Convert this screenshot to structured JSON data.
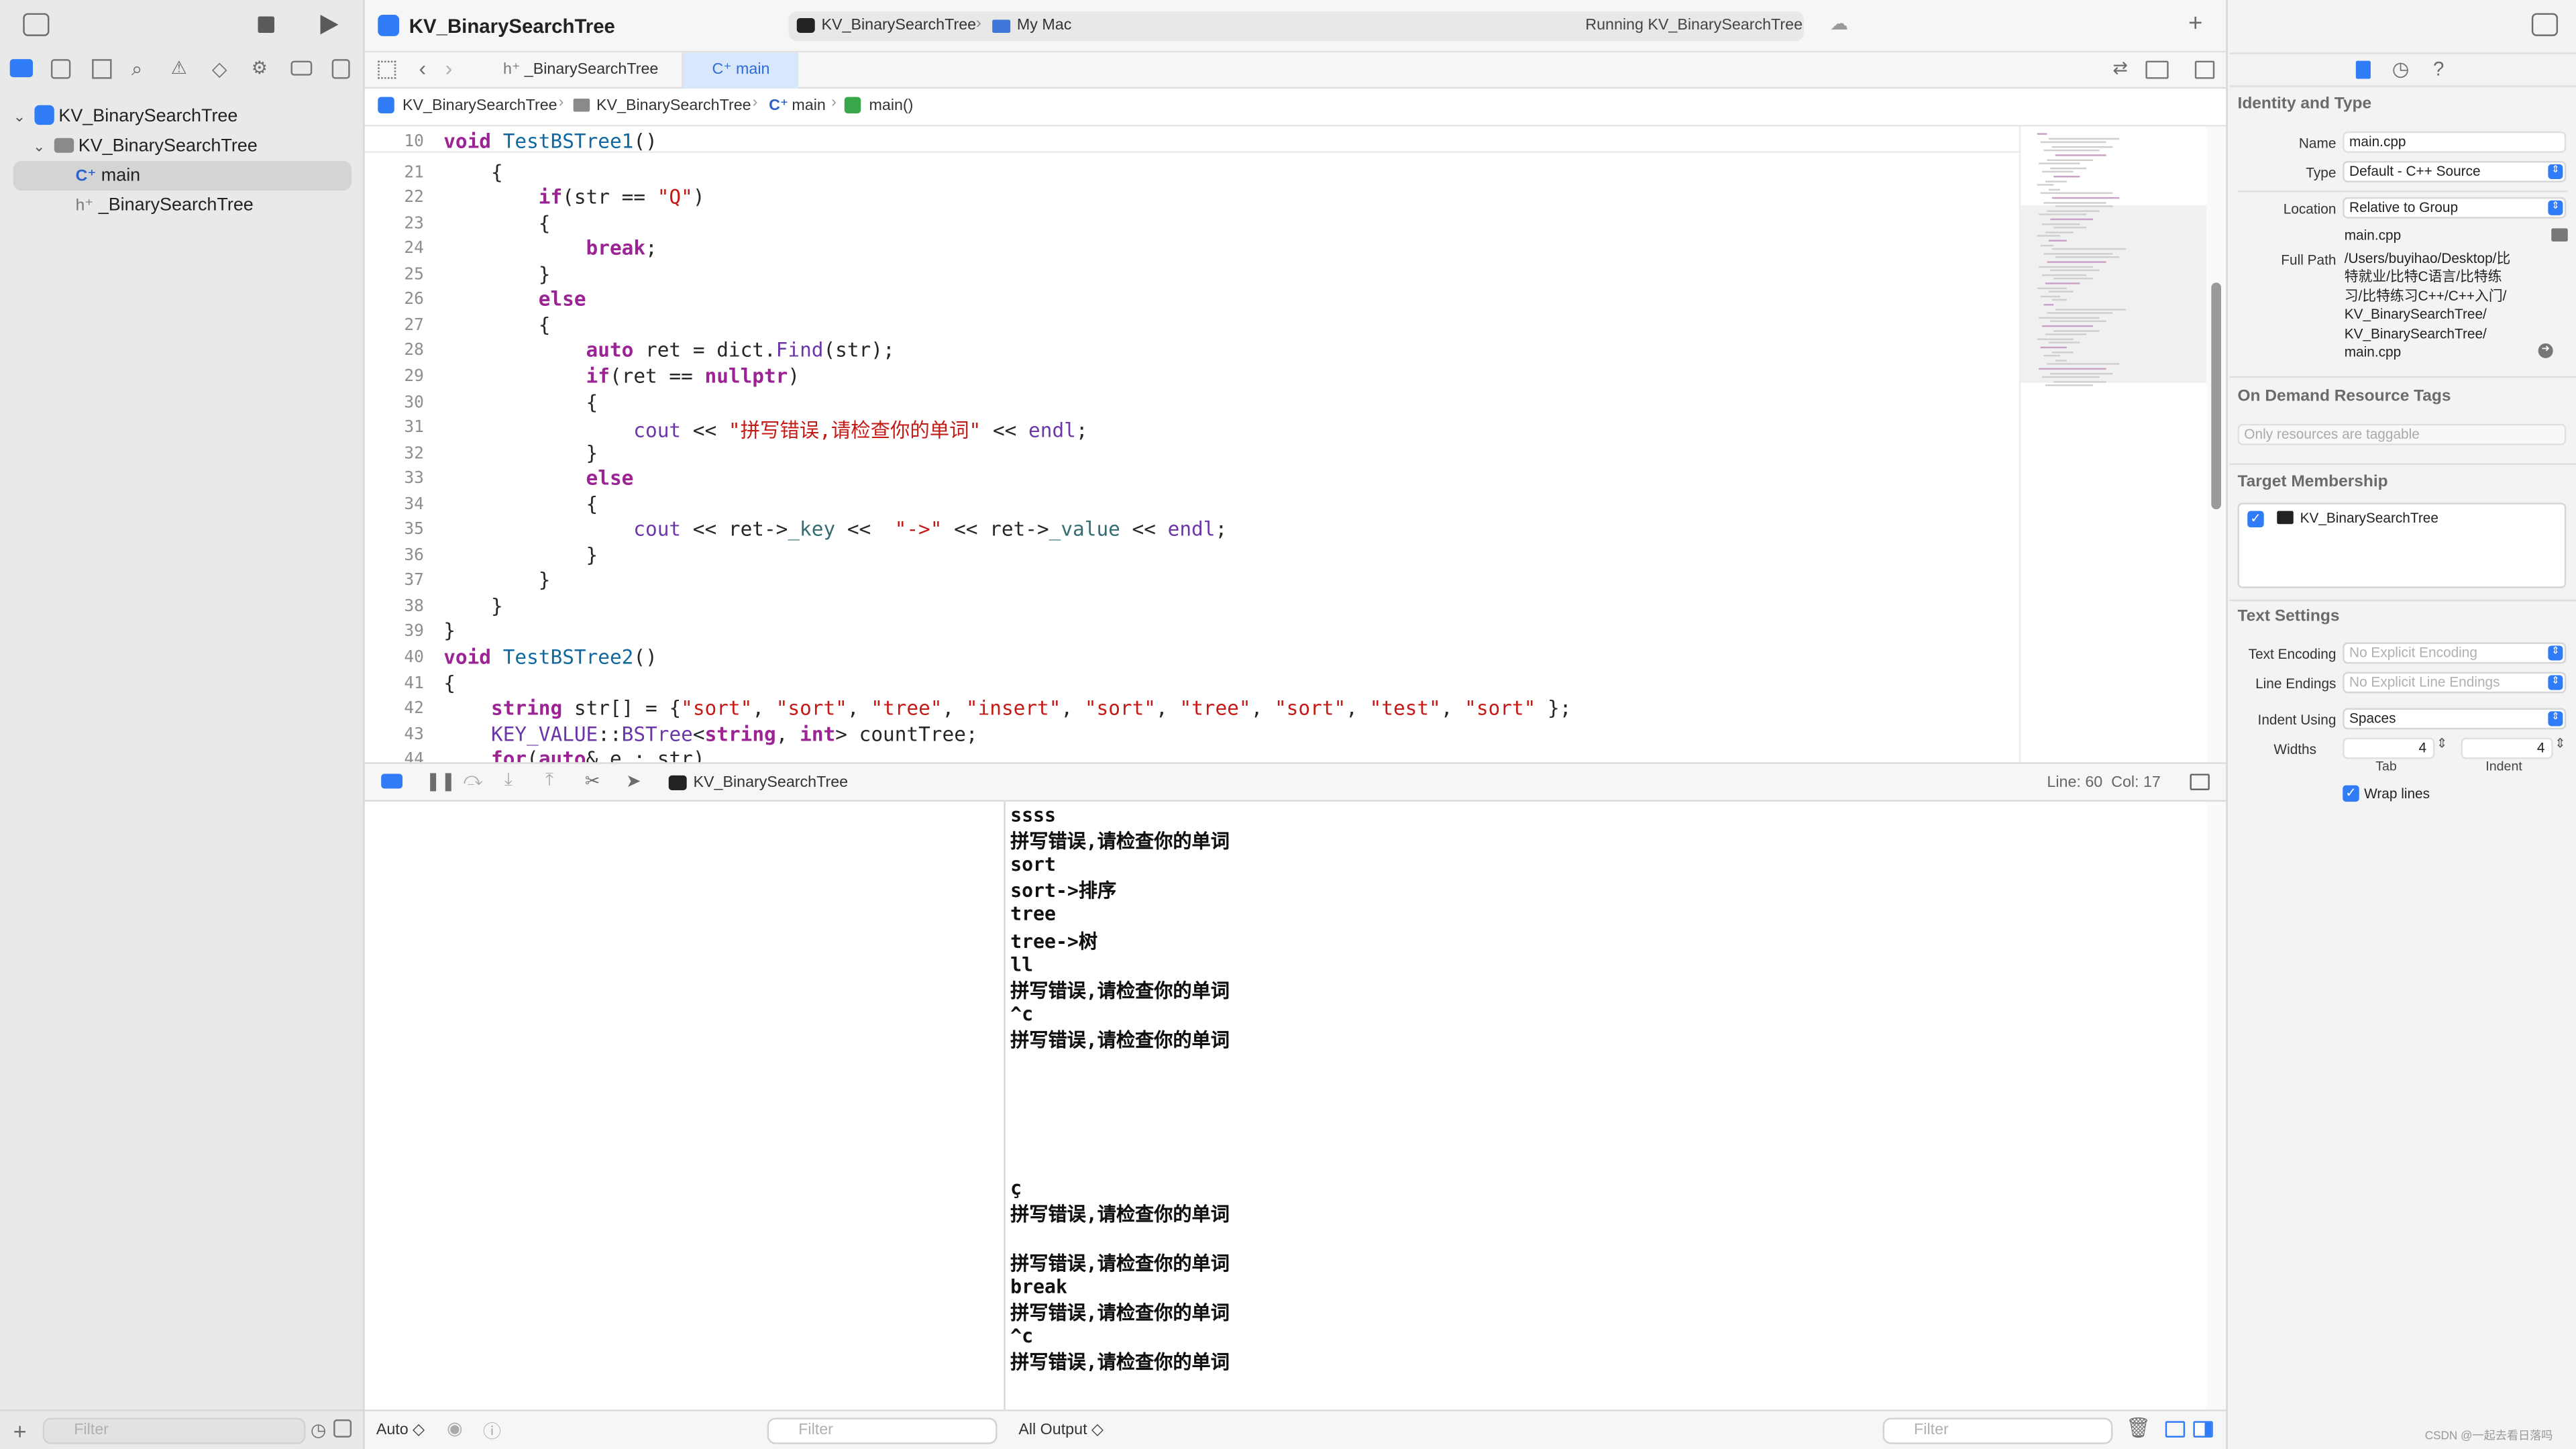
{
  "app": {
    "project": "KV_BinarySearchTree",
    "scheme": "KV_BinarySearchTree",
    "destination": "My Mac",
    "status": "Running KV_BinarySearchTree"
  },
  "tabs": [
    {
      "label": "_BinarySearchTree"
    },
    {
      "label": "main"
    }
  ],
  "jump": {
    "project": "KV_BinarySearchTree",
    "folder": "KV_BinarySearchTree",
    "file": "main",
    "symbol": "main()"
  },
  "navigator": {
    "root": "KV_BinarySearchTree",
    "group": "KV_BinarySearchTree",
    "files": [
      "main",
      "_BinarySearchTree"
    ],
    "filter_placeholder": "Filter"
  },
  "editor": {
    "lines": [
      {
        "n": "10",
        "t": "void TestBSTree1()"
      },
      {
        "n": "21",
        "t": "    {"
      },
      {
        "n": "22",
        "t": "        if(str == \"Q\")"
      },
      {
        "n": "23",
        "t": "        {"
      },
      {
        "n": "24",
        "t": "            break;"
      },
      {
        "n": "25",
        "t": "        }"
      },
      {
        "n": "26",
        "t": "        else"
      },
      {
        "n": "27",
        "t": "        {"
      },
      {
        "n": "28",
        "t": "            auto ret = dict.Find(str);"
      },
      {
        "n": "29",
        "t": "            if(ret == nullptr)"
      },
      {
        "n": "30",
        "t": "            {"
      },
      {
        "n": "31",
        "t": "                cout << \"拼写错误,请检查你的单词\" << endl;"
      },
      {
        "n": "32",
        "t": "            }"
      },
      {
        "n": "33",
        "t": "            else"
      },
      {
        "n": "34",
        "t": "            {"
      },
      {
        "n": "35",
        "t": "                cout << ret->_key <<  \"->\" << ret->_value << endl;"
      },
      {
        "n": "36",
        "t": "            }"
      },
      {
        "n": "37",
        "t": "        }"
      },
      {
        "n": "38",
        "t": "    }"
      },
      {
        "n": "39",
        "t": "}"
      },
      {
        "n": "40",
        "t": "void TestBSTree2()"
      },
      {
        "n": "41",
        "t": "{"
      },
      {
        "n": "42",
        "t": "    string str[] = {\"sort\", \"sort\", \"tree\", \"insert\", \"sort\", \"tree\", \"sort\", \"test\", \"sort\" };"
      },
      {
        "n": "43",
        "t": "    KEY_VALUE::BSTree<string, int> countTree;"
      },
      {
        "n": "44",
        "t": "    for(auto& e : str)"
      }
    ]
  },
  "debug": {
    "process": "KV_BinarySearchTree",
    "position": "Line: 60  Col: 17"
  },
  "console": {
    "lines": [
      "ssss",
      "拼写错误,请检查你的单词",
      "sort",
      "sort->排序",
      "tree",
      "tree->树",
      "ll",
      "拼写错误,请检查你的单词",
      "^c",
      "拼写错误,请检查你的单词",
      "",
      "",
      "",
      "",
      "",
      "ç",
      "拼写错误,请检查你的单词",
      "",
      "拼写错误,请检查你的单词",
      "break",
      "拼写错误,请检查你的单词",
      "^c",
      "拼写错误,请检查你的单词"
    ]
  },
  "bottom": {
    "auto": "Auto ◇",
    "filter": "Filter",
    "output": "All Output ◇",
    "filter2": "Filter"
  },
  "inspector": {
    "identity_title": "Identity and Type",
    "name_label": "Name",
    "name": "main.cpp",
    "type_label": "Type",
    "type": "Default - C++ Source",
    "location_label": "Location",
    "location": "Relative to Group",
    "location_file": "main.cpp",
    "fullpath_label": "Full Path",
    "fullpath": [
      "/Users/buyihao/Desktop/比",
      "特就业/比特C语言/比特练",
      "习/比特练习C++/C++入门/",
      "KV_BinarySearchTree/",
      "KV_BinarySearchTree/",
      "main.cpp"
    ],
    "odr_title": "On Demand Resource Tags",
    "odr_placeholder": "Only resources are taggable",
    "target_title": "Target Membership",
    "target": "KV_BinarySearchTree",
    "text_title": "Text Settings",
    "enc_label": "Text Encoding",
    "enc": "No Explicit Encoding",
    "le_label": "Line Endings",
    "le": "No Explicit Line Endings",
    "indent_label": "Indent Using",
    "indent": "Spaces",
    "widths_label": "Widths",
    "tab_val": "4",
    "indent_val": "4",
    "tab_label": "Tab",
    "indent_sub": "Indent",
    "wrap": "Wrap lines"
  },
  "watermark": "CSDN @一起去看日落吗"
}
